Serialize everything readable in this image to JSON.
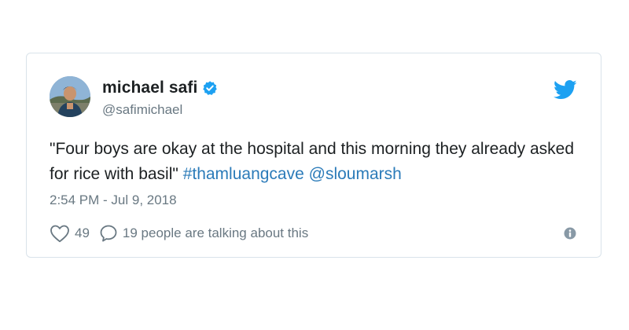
{
  "tweet": {
    "display_name": "michael safi",
    "handle": "@safimichael",
    "verified": true,
    "text_main": "\"Four boys are okay at the hospital and this morning they already asked for rice with basil\"",
    "hashtag": "#thamluangcave",
    "mention": "@sloumarsh",
    "timestamp": "2:54 PM - Jul 9, 2018",
    "likes_count": "49",
    "talking_text": "19 people are talking about this"
  },
  "icons": {
    "verified": "verified-badge-icon",
    "logo": "twitter-bird-icon",
    "like": "heart-icon",
    "reply": "speech-bubble-icon",
    "info": "info-icon"
  },
  "colors": {
    "text": "#1c2022",
    "muted": "#697882",
    "link": "#2b7bb9",
    "brand": "#1da1f2",
    "border": "#d9e3ea"
  }
}
